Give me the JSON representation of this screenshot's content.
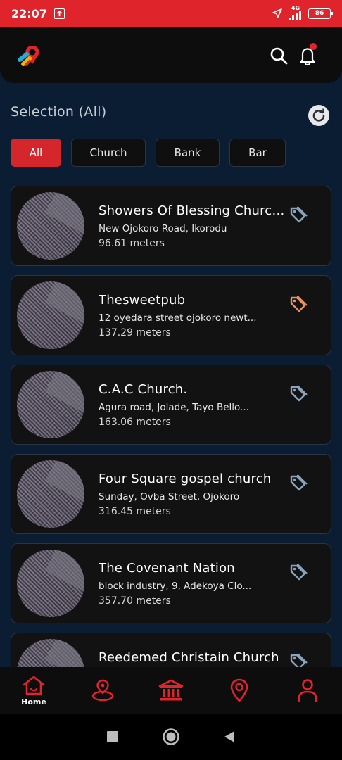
{
  "status_bar": {
    "time": "22:07",
    "network": "4G",
    "battery": "86"
  },
  "header": {
    "logo_icon": "map-pin-logo-icon",
    "search_icon": "search-icon",
    "bell_icon": "bell-icon"
  },
  "selection": {
    "title": "Selection (All)",
    "refresh_icon": "refresh-icon"
  },
  "filters": [
    {
      "label": "All",
      "active": true
    },
    {
      "label": "Church",
      "active": false
    },
    {
      "label": "Bank",
      "active": false
    },
    {
      "label": "Bar",
      "active": false
    }
  ],
  "places": [
    {
      "name": "Showers Of Blessing Church ...",
      "address": "New Ojokoro Road, Ikorodu",
      "distance": "96.61 meters",
      "tag_color": "#8aa4bd"
    },
    {
      "name": "Thesweetpub",
      "address": "12 oyedara street ojokoro newt...",
      "distance": "137.29 meters",
      "tag_color": "#e8935f"
    },
    {
      "name": "C.A.C Church.",
      "address": "Agura road, Jolade, Tayo Bello...",
      "distance": "163.06 meters",
      "tag_color": "#8aa4bd"
    },
    {
      "name": "Four Square gospel church",
      "address": "Sunday, Ovba Street, Ojokoro",
      "distance": "316.45 meters",
      "tag_color": "#8aa4bd"
    },
    {
      "name": "The Covenant Nation",
      "address": "block industry, 9, Adekoya Clo...",
      "distance": "357.70 meters",
      "tag_color": "#8aa4bd"
    },
    {
      "name": "Reedemed Christain Church",
      "address": "",
      "distance": "",
      "tag_color": "#8aa4bd"
    }
  ],
  "bottom_nav": {
    "items": [
      {
        "label": "Home",
        "icon": "home-icon"
      },
      {
        "label": "",
        "icon": "location-radius-icon"
      },
      {
        "label": "",
        "icon": "bank-icon"
      },
      {
        "label": "",
        "icon": "map-pin-icon"
      },
      {
        "label": "",
        "icon": "profile-icon"
      }
    ]
  },
  "colors": {
    "accent": "#d5262c",
    "background": "#0b1d33",
    "card": "#121212"
  }
}
